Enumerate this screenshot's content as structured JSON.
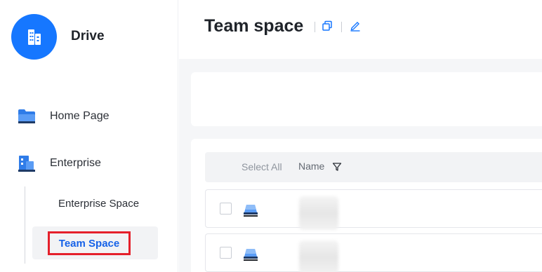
{
  "app": {
    "name": "Drive"
  },
  "sidebar": {
    "items": [
      {
        "label": "Home Page",
        "icon": "folder-icon"
      },
      {
        "label": "Enterprise",
        "icon": "building-icon"
      }
    ],
    "sub_items": [
      {
        "label": "Enterprise Space",
        "active": false
      },
      {
        "label": "Team Space",
        "active": true
      }
    ]
  },
  "header": {
    "title": "Team space",
    "icons": [
      "copy-icon",
      "edit-icon"
    ]
  },
  "table": {
    "select_all_label": "Select All",
    "name_header": "Name",
    "rows": [
      {
        "icon": "drive-disk-icon",
        "name": ""
      },
      {
        "icon": "drive-disk-icon",
        "name": ""
      }
    ]
  },
  "colors": {
    "accent": "#1677ff",
    "active_text": "#1662e8",
    "highlight_border": "#e5202b"
  }
}
